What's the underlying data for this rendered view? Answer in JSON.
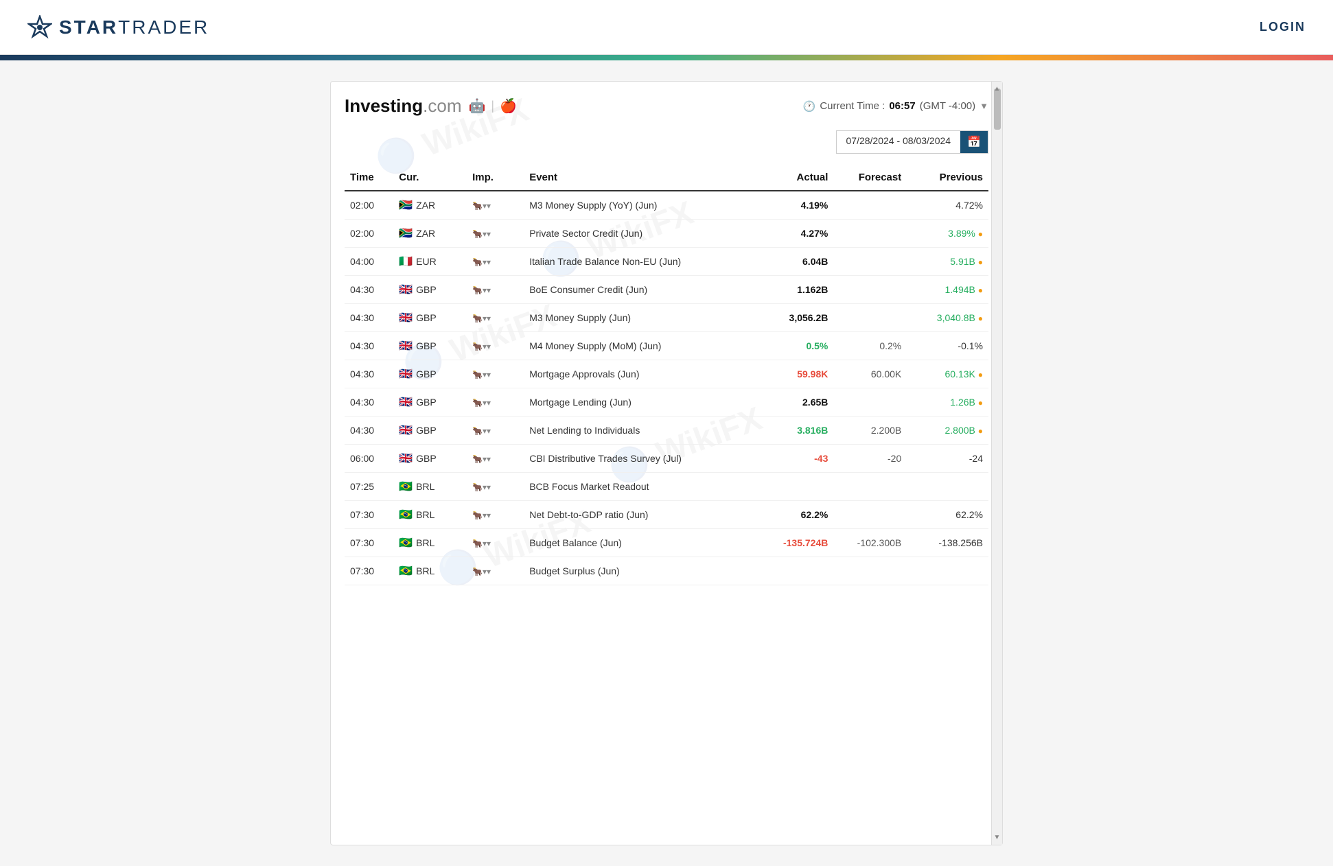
{
  "header": {
    "logo_star": "✦",
    "logo_text_bold": "STAR",
    "logo_text_light": "TRADER",
    "login_label": "LOGIN"
  },
  "widget": {
    "brand": "Investing",
    "brand_suffix": ".com",
    "android_icon": "🤖",
    "apple_icon": "",
    "divider": "|",
    "current_time_label": "Current Time :",
    "current_time_value": "06:57",
    "timezone": "(GMT -4:00)",
    "date_range": "07/28/2024 - 08/03/2024",
    "table": {
      "headers": {
        "time": "Time",
        "currency": "Cur.",
        "importance": "Imp.",
        "event": "Event",
        "actual": "Actual",
        "forecast": "Forecast",
        "previous": "Previous"
      },
      "rows": [
        {
          "time": "02:00",
          "flag": "🇿🇦",
          "currency": "ZAR",
          "importance": 1,
          "event": "M3 Money Supply (YoY) (Jun)",
          "actual": "4.19%",
          "actual_color": "bold",
          "forecast": "",
          "previous": "4.72%",
          "previous_color": "normal",
          "dot": false
        },
        {
          "time": "02:00",
          "flag": "🇿🇦",
          "currency": "ZAR",
          "importance": 1,
          "event": "Private Sector Credit (Jun)",
          "actual": "4.27%",
          "actual_color": "bold",
          "forecast": "",
          "previous": "3.89%",
          "previous_color": "green",
          "dot": true
        },
        {
          "time": "04:00",
          "flag": "🇮🇹",
          "currency": "EUR",
          "importance": 1,
          "event": "Italian Trade Balance Non-EU (Jun)",
          "actual": "6.04B",
          "actual_color": "bold",
          "forecast": "",
          "previous": "5.91B",
          "previous_color": "green",
          "dot": true
        },
        {
          "time": "04:30",
          "flag": "🇬🇧",
          "currency": "GBP",
          "importance": 1,
          "event": "BoE Consumer Credit (Jun)",
          "actual": "1.162B",
          "actual_color": "bold",
          "forecast": "",
          "previous": "1.494B",
          "previous_color": "green",
          "dot": true
        },
        {
          "time": "04:30",
          "flag": "🇬🇧",
          "currency": "GBP",
          "importance": 1,
          "event": "M3 Money Supply (Jun)",
          "actual": "3,056.2B",
          "actual_color": "bold",
          "forecast": "",
          "previous": "3,040.8B",
          "previous_color": "green",
          "dot": true
        },
        {
          "time": "04:30",
          "flag": "🇬🇧",
          "currency": "GBP",
          "importance": 1,
          "event": "M4 Money Supply (MoM) (Jun)",
          "actual": "0.5%",
          "actual_color": "green",
          "forecast": "0.2%",
          "previous": "-0.1%",
          "previous_color": "normal",
          "dot": false
        },
        {
          "time": "04:30",
          "flag": "🇬🇧",
          "currency": "GBP",
          "importance": 1,
          "event": "Mortgage Approvals (Jun)",
          "actual": "59.98K",
          "actual_color": "red",
          "forecast": "60.00K",
          "previous": "60.13K",
          "previous_color": "green",
          "dot": true
        },
        {
          "time": "04:30",
          "flag": "🇬🇧",
          "currency": "GBP",
          "importance": 1,
          "event": "Mortgage Lending (Jun)",
          "actual": "2.65B",
          "actual_color": "bold",
          "forecast": "",
          "previous": "1.26B",
          "previous_color": "green",
          "dot": true
        },
        {
          "time": "04:30",
          "flag": "🇬🇧",
          "currency": "GBP",
          "importance": 1,
          "event": "Net Lending to Individuals",
          "actual": "3.816B",
          "actual_color": "green",
          "forecast": "2.200B",
          "previous": "2.800B",
          "previous_color": "green",
          "dot": true
        },
        {
          "time": "06:00",
          "flag": "🇬🇧",
          "currency": "GBP",
          "importance": 1,
          "event": "CBI Distributive Trades Survey (Jul)",
          "actual": "-43",
          "actual_color": "red",
          "forecast": "-20",
          "previous": "-24",
          "previous_color": "normal",
          "dot": false
        },
        {
          "time": "07:25",
          "flag": "🇧🇷",
          "currency": "BRL",
          "importance": 1,
          "event": "BCB Focus Market Readout",
          "actual": "",
          "actual_color": "normal",
          "forecast": "",
          "previous": "",
          "previous_color": "normal",
          "dot": false
        },
        {
          "time": "07:30",
          "flag": "🇧🇷",
          "currency": "BRL",
          "importance": 1,
          "event": "Net Debt-to-GDP ratio (Jun)",
          "actual": "62.2%",
          "actual_color": "bold",
          "forecast": "",
          "previous": "62.2%",
          "previous_color": "normal",
          "dot": false
        },
        {
          "time": "07:30",
          "flag": "🇧🇷",
          "currency": "BRL",
          "importance": 1,
          "event": "Budget Balance (Jun)",
          "actual": "-135.724B",
          "actual_color": "red",
          "forecast": "-102.300B",
          "previous": "-138.256B",
          "previous_color": "normal",
          "dot": false
        },
        {
          "time": "07:30",
          "flag": "🇧🇷",
          "currency": "BRL",
          "importance": 1,
          "event": "Budget Surplus (Jun)",
          "actual": "",
          "actual_color": "normal",
          "forecast": "",
          "previous": "",
          "previous_color": "normal",
          "dot": false
        }
      ]
    }
  }
}
